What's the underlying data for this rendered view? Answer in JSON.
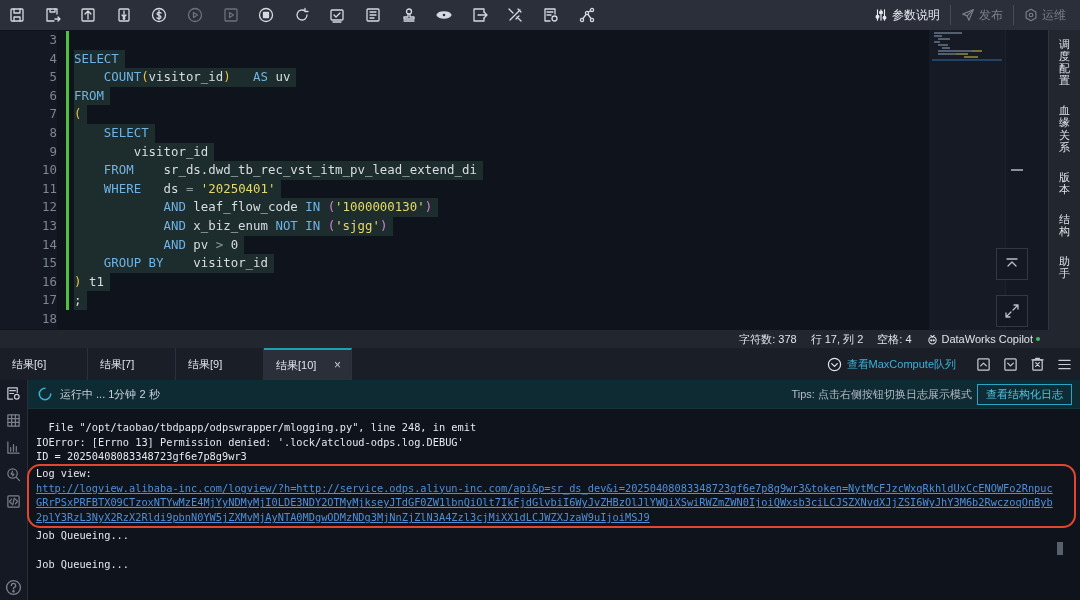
{
  "toolbar": {
    "icons": [
      {
        "kind": "save",
        "disabled": false
      },
      {
        "kind": "save-as",
        "disabled": false
      },
      {
        "kind": "upload",
        "disabled": false
      },
      {
        "kind": "file-download",
        "disabled": false
      },
      {
        "kind": "cost",
        "disabled": false
      },
      {
        "kind": "run",
        "disabled": true
      },
      {
        "kind": "run-box",
        "disabled": true
      },
      {
        "kind": "stop",
        "disabled": false
      },
      {
        "kind": "refresh",
        "disabled": false
      },
      {
        "kind": "check",
        "disabled": false
      },
      {
        "kind": "document",
        "disabled": false
      },
      {
        "kind": "stamp",
        "disabled": false
      },
      {
        "kind": "eye",
        "disabled": false
      },
      {
        "kind": "export",
        "disabled": false
      },
      {
        "kind": "tools",
        "disabled": false
      },
      {
        "kind": "doc-gear",
        "disabled": false
      },
      {
        "kind": "graph",
        "disabled": false
      }
    ],
    "actions": [
      {
        "kind": "sliders",
        "label": "参数说明",
        "disabled": false
      },
      {
        "kind": "publish",
        "label": "发布",
        "disabled": true
      },
      {
        "kind": "ops",
        "label": "运维",
        "disabled": true
      }
    ]
  },
  "editor": {
    "lines": [
      {
        "no": "3",
        "selected": false,
        "changed": true
      },
      {
        "no": "4",
        "selected": true,
        "changed": true,
        "tokens": [
          {
            "kind": "keyword",
            "text": "SELECT"
          }
        ]
      },
      {
        "no": "5",
        "selected": true,
        "changed": true,
        "tokens": [
          {
            "kind": "keyword",
            "text": "    COUNT"
          },
          {
            "kind": "paren",
            "text": "("
          },
          {
            "kind": "plain",
            "text": "visitor_id"
          },
          {
            "kind": "paren",
            "text": ")"
          },
          {
            "kind": "keyword",
            "text": "   AS"
          },
          {
            "kind": "plain",
            "text": " uv"
          }
        ]
      },
      {
        "no": "6",
        "selected": true,
        "changed": true,
        "tokens": [
          {
            "kind": "keyword",
            "text": "FROM"
          }
        ]
      },
      {
        "no": "7",
        "selected": true,
        "changed": true,
        "tokens": [
          {
            "kind": "paren",
            "text": "("
          }
        ]
      },
      {
        "no": "8",
        "selected": true,
        "changed": true,
        "tokens": [
          {
            "kind": "keyword",
            "text": "    SELECT"
          }
        ]
      },
      {
        "no": "9",
        "selected": true,
        "changed": true,
        "tokens": [
          {
            "kind": "plain",
            "text": "        visitor_id"
          }
        ]
      },
      {
        "no": "10",
        "selected": true,
        "changed": true,
        "tokens": [
          {
            "kind": "keyword",
            "text": "    FROM"
          },
          {
            "kind": "plain",
            "text": "    sr_ds.dwd_tb_rec_vst_itm_pv_lead_extend_di"
          }
        ]
      },
      {
        "no": "11",
        "selected": true,
        "changed": true,
        "tokens": [
          {
            "kind": "keyword",
            "text": "    WHERE"
          },
          {
            "kind": "plain",
            "text": "   ds "
          },
          {
            "kind": "operator",
            "text": "="
          },
          {
            "kind": "string",
            "text": " '20250401'"
          }
        ]
      },
      {
        "no": "12",
        "selected": true,
        "changed": true,
        "tokens": [
          {
            "kind": "keyword",
            "text": "            AND"
          },
          {
            "kind": "plain",
            "text": " leaf_flow_code "
          },
          {
            "kind": "keyword",
            "text": "IN"
          },
          {
            "kind": "paren2",
            "text": " ("
          },
          {
            "kind": "string",
            "text": "'1000000130'"
          },
          {
            "kind": "paren2",
            "text": ")"
          }
        ]
      },
      {
        "no": "13",
        "selected": true,
        "changed": true,
        "tokens": [
          {
            "kind": "keyword",
            "text": "            AND"
          },
          {
            "kind": "plain",
            "text": " x_biz_enum "
          },
          {
            "kind": "keyword",
            "text": "NOT IN"
          },
          {
            "kind": "paren2",
            "text": " ("
          },
          {
            "kind": "string",
            "text": "'sjgg'"
          },
          {
            "kind": "paren2",
            "text": ")"
          }
        ]
      },
      {
        "no": "14",
        "selected": true,
        "changed": true,
        "tokens": [
          {
            "kind": "keyword",
            "text": "            AND"
          },
          {
            "kind": "plain",
            "text": " pv "
          },
          {
            "kind": "operator",
            "text": ">"
          },
          {
            "kind": "plain",
            "text": " 0"
          }
        ]
      },
      {
        "no": "15",
        "selected": true,
        "changed": true,
        "tokens": [
          {
            "kind": "keyword",
            "text": "    GROUP BY"
          },
          {
            "kind": "plain",
            "text": "    visitor_id"
          }
        ]
      },
      {
        "no": "16",
        "selected": true,
        "changed": true,
        "tokens": [
          {
            "kind": "paren",
            "text": ")"
          },
          {
            "kind": "plain",
            "text": " t1"
          }
        ]
      },
      {
        "no": "17",
        "selected": true,
        "changed": true,
        "tokens": [
          {
            "kind": "plain",
            "text": ";"
          }
        ]
      },
      {
        "no": "18",
        "selected": false,
        "changed": false
      }
    ]
  },
  "side_panel": [
    "调度配置",
    "血缘关系",
    "版本",
    "结构",
    "助手"
  ],
  "status_bar": {
    "items": [
      "字符数: 378",
      "行 17, 列 2",
      "空格: 4"
    ],
    "copilot": {
      "label": "DataWorks Copilot",
      "online": true
    }
  },
  "result_tabs": [
    {
      "label": "结果[6]",
      "selected": false
    },
    {
      "label": "结果[7]",
      "selected": false
    },
    {
      "label": "结果[9]",
      "selected": false
    },
    {
      "label": "结果[10]",
      "selected": true,
      "close": "×"
    }
  ],
  "queue_link": "查看MaxCompute队列",
  "run_status": {
    "text": "运行中 ... 1分钟 2 秒",
    "tips": "Tips: 点击右侧按钮切换日志展示模式",
    "button": "查看结构化日志"
  },
  "log": [
    {
      "kind": "text",
      "text": "  File \"/opt/taobao/tbdpapp/odpswrapper/mlogging.py\", line 248, in emit"
    },
    {
      "kind": "text",
      "text": "IOError: [Errno 13] Permission denied: '.lock/atcloud-odps.log.DEBUG'"
    },
    {
      "kind": "text",
      "text": "ID = 20250408083348723gf6e7p8g9wr3"
    },
    {
      "kind": "highlight",
      "lines": [
        {
          "kind": "text",
          "text": "Log view:"
        },
        {
          "kind": "link",
          "text": "http://logview.alibaba-inc.com/logview/?h=http://service.odps.aliyun-inc.com/api&p=sr_ds_dev&i=20250408083348723gf6e7p8g9wr3&token=NytMcFJzcWxqRkhldUxCcENOWFo2Rnpuc"
        },
        {
          "kind": "link",
          "text": "GRrPSxPRFBTX09CTzoxNTYwMzE4MjYyNDMyMjI0LDE3NDY2OTMyMjkseyJTdGF0ZW1lbnQiOlt7IkFjdGlvbiI6WyJvZHBzOlJlYWQiXSwiRWZmZWN0IjoiQWxsb3ciLCJSZXNvdXJjZSI6WyJhY3M6b2RwczoqOnByb"
        },
        {
          "kind": "link",
          "text": "2plY3RzL3NyX2RzX2Rldi9pbnN0YW5jZXMvMjAyNTA0MDgwODMzNDg3MjNnZjZlN3A4Zzl3cjMiXX1dLCJWZXJzaW9uIjoiMSJ9"
        }
      ]
    },
    {
      "kind": "text",
      "text": "Job Queueing..."
    },
    {
      "kind": "blank"
    },
    {
      "kind": "text",
      "text": "Job Queueing..."
    }
  ]
}
